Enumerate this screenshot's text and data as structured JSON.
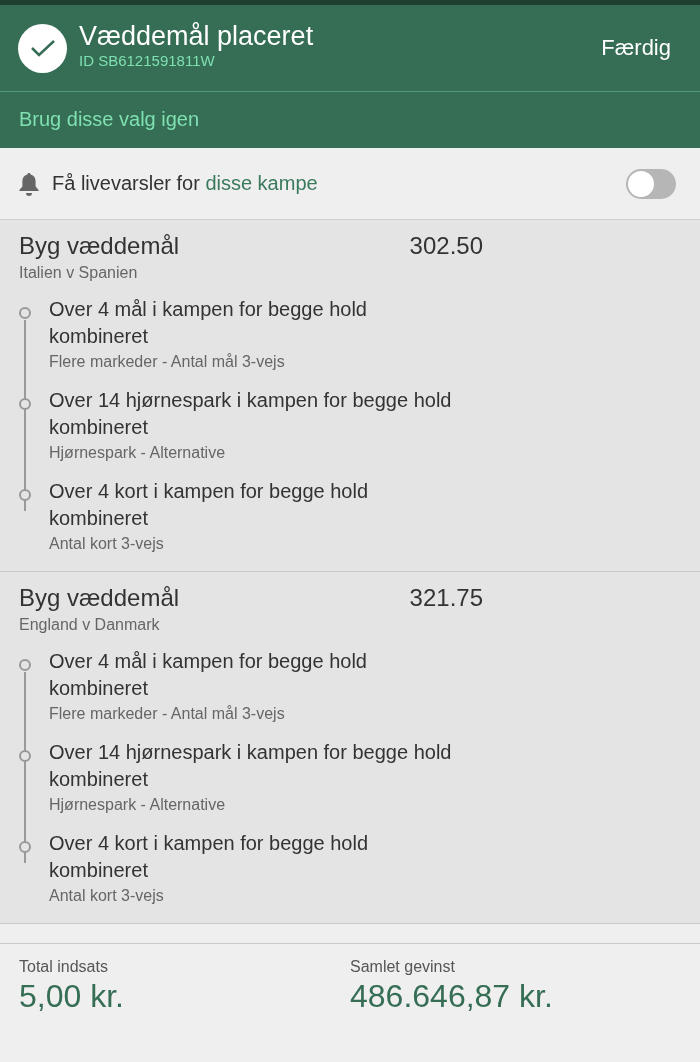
{
  "header": {
    "title": "Væddemål placeret",
    "bet_id": "ID SB6121591811W",
    "done_button": "Færdig",
    "reuse_link": "Brug disse valg igen"
  },
  "alerts": {
    "text": "Få livevarsler for",
    "link": "disse kampe",
    "on": false
  },
  "bets": [
    {
      "title": "Byg væddemål",
      "odds": "302.50",
      "match": "Italien v Spanien",
      "selections": [
        {
          "name": "Over 4 mål i kampen for begge hold kombineret",
          "market": "Flere markeder - Antal mål 3-vejs"
        },
        {
          "name": "Over 14 hjørnespark i kampen for begge hold kombineret",
          "market": "Hjørnespark - Alternative"
        },
        {
          "name": "Over 4 kort i kampen for begge hold kombineret",
          "market": "Antal kort 3-vejs"
        }
      ]
    },
    {
      "title": "Byg væddemål",
      "odds": "321.75",
      "match": "England v Danmark",
      "selections": [
        {
          "name": "Over 4 mål i kampen for begge hold kombineret",
          "market": "Flere markeder - Antal mål 3-vejs"
        },
        {
          "name": "Over 14 hjørnespark i kampen for begge hold kombineret",
          "market": "Hjørnespark - Alternative"
        },
        {
          "name": "Over 4 kort i kampen for begge hold kombineret",
          "market": "Antal kort 3-vejs"
        }
      ]
    }
  ],
  "footer": [
    {
      "label": "Total indsats",
      "value": "5,00 kr."
    },
    {
      "label": "Samlet gevinst",
      "value": "486.646,87 kr."
    }
  ]
}
